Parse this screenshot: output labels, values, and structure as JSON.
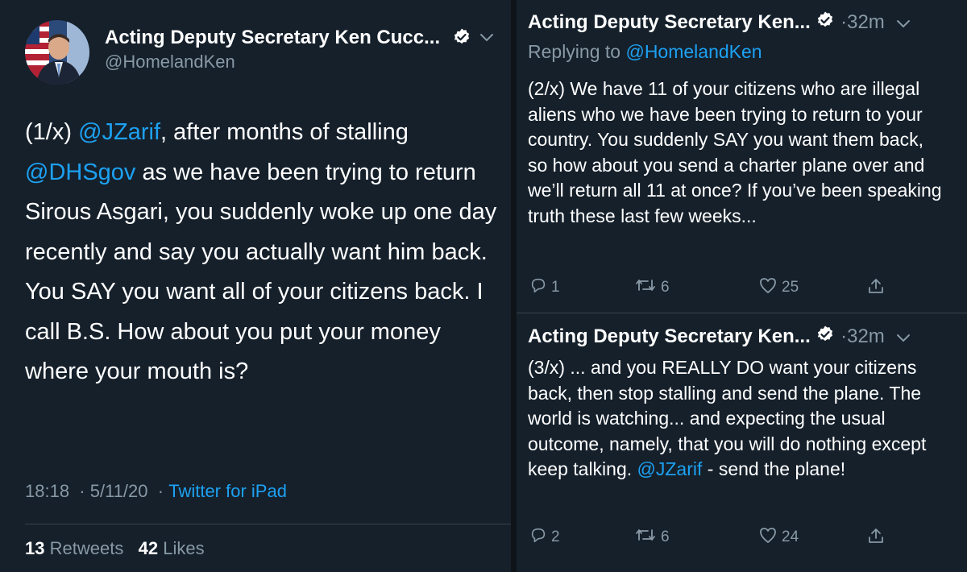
{
  "main_tweet": {
    "author_name": "Acting Deputy Secretary Ken Cucc...",
    "handle": "@HomelandKen",
    "text_parts": {
      "p1": "(1/x) ",
      "mention1": "@JZarif",
      "p2": ", after months of stalling ",
      "mention2": "@DHSgov",
      "p3": " as we have been trying to return Sirous Asgari, you suddenly woke up one day recently and say you actually want him back. You SAY you want all of your citizens back. I call B.S. How about you put your money where your mouth is?"
    },
    "time": "18:18",
    "date": "5/11/20",
    "source": "Twitter for iPad",
    "retweets_count": "13",
    "retweets_label": "Retweets",
    "likes_count": "42",
    "likes_label": "Likes"
  },
  "replies": [
    {
      "author_name": "Acting Deputy Secretary Ken...",
      "time_ago": "32m",
      "replying_to_label": "Replying to",
      "replying_to_handle": "@HomelandKen",
      "text": "(2/x) We have 11 of your citizens who are illegal aliens who we have been trying to return to your country. You suddenly SAY you want them back, so how about you send a charter plane over and we’ll return all 11 at once? If you’ve been speaking truth these last few weeks...",
      "replies_count": "1",
      "retweets_count": "6",
      "likes_count": "25"
    },
    {
      "author_name": "Acting Deputy Secretary Ken...",
      "time_ago": "32m",
      "text_main": "(3/x) ... and you REALLY DO want your citizens back, then stop stalling and send the plane. The world is watching... and expecting the usual outcome, namely, that you will do nothing except keep talking. ",
      "mention": "@JZarif",
      "text_end": " - send the plane!",
      "replies_count": "2",
      "retweets_count": "6",
      "likes_count": "24"
    }
  ],
  "colors": {
    "background": "#15202b",
    "link": "#1da1f2",
    "secondary_text": "#8899a6",
    "verified": "#ffffff"
  },
  "icons": [
    "verified-badge-icon",
    "chevron-down-icon",
    "reply-icon",
    "retweet-icon",
    "like-icon",
    "share-icon"
  ]
}
